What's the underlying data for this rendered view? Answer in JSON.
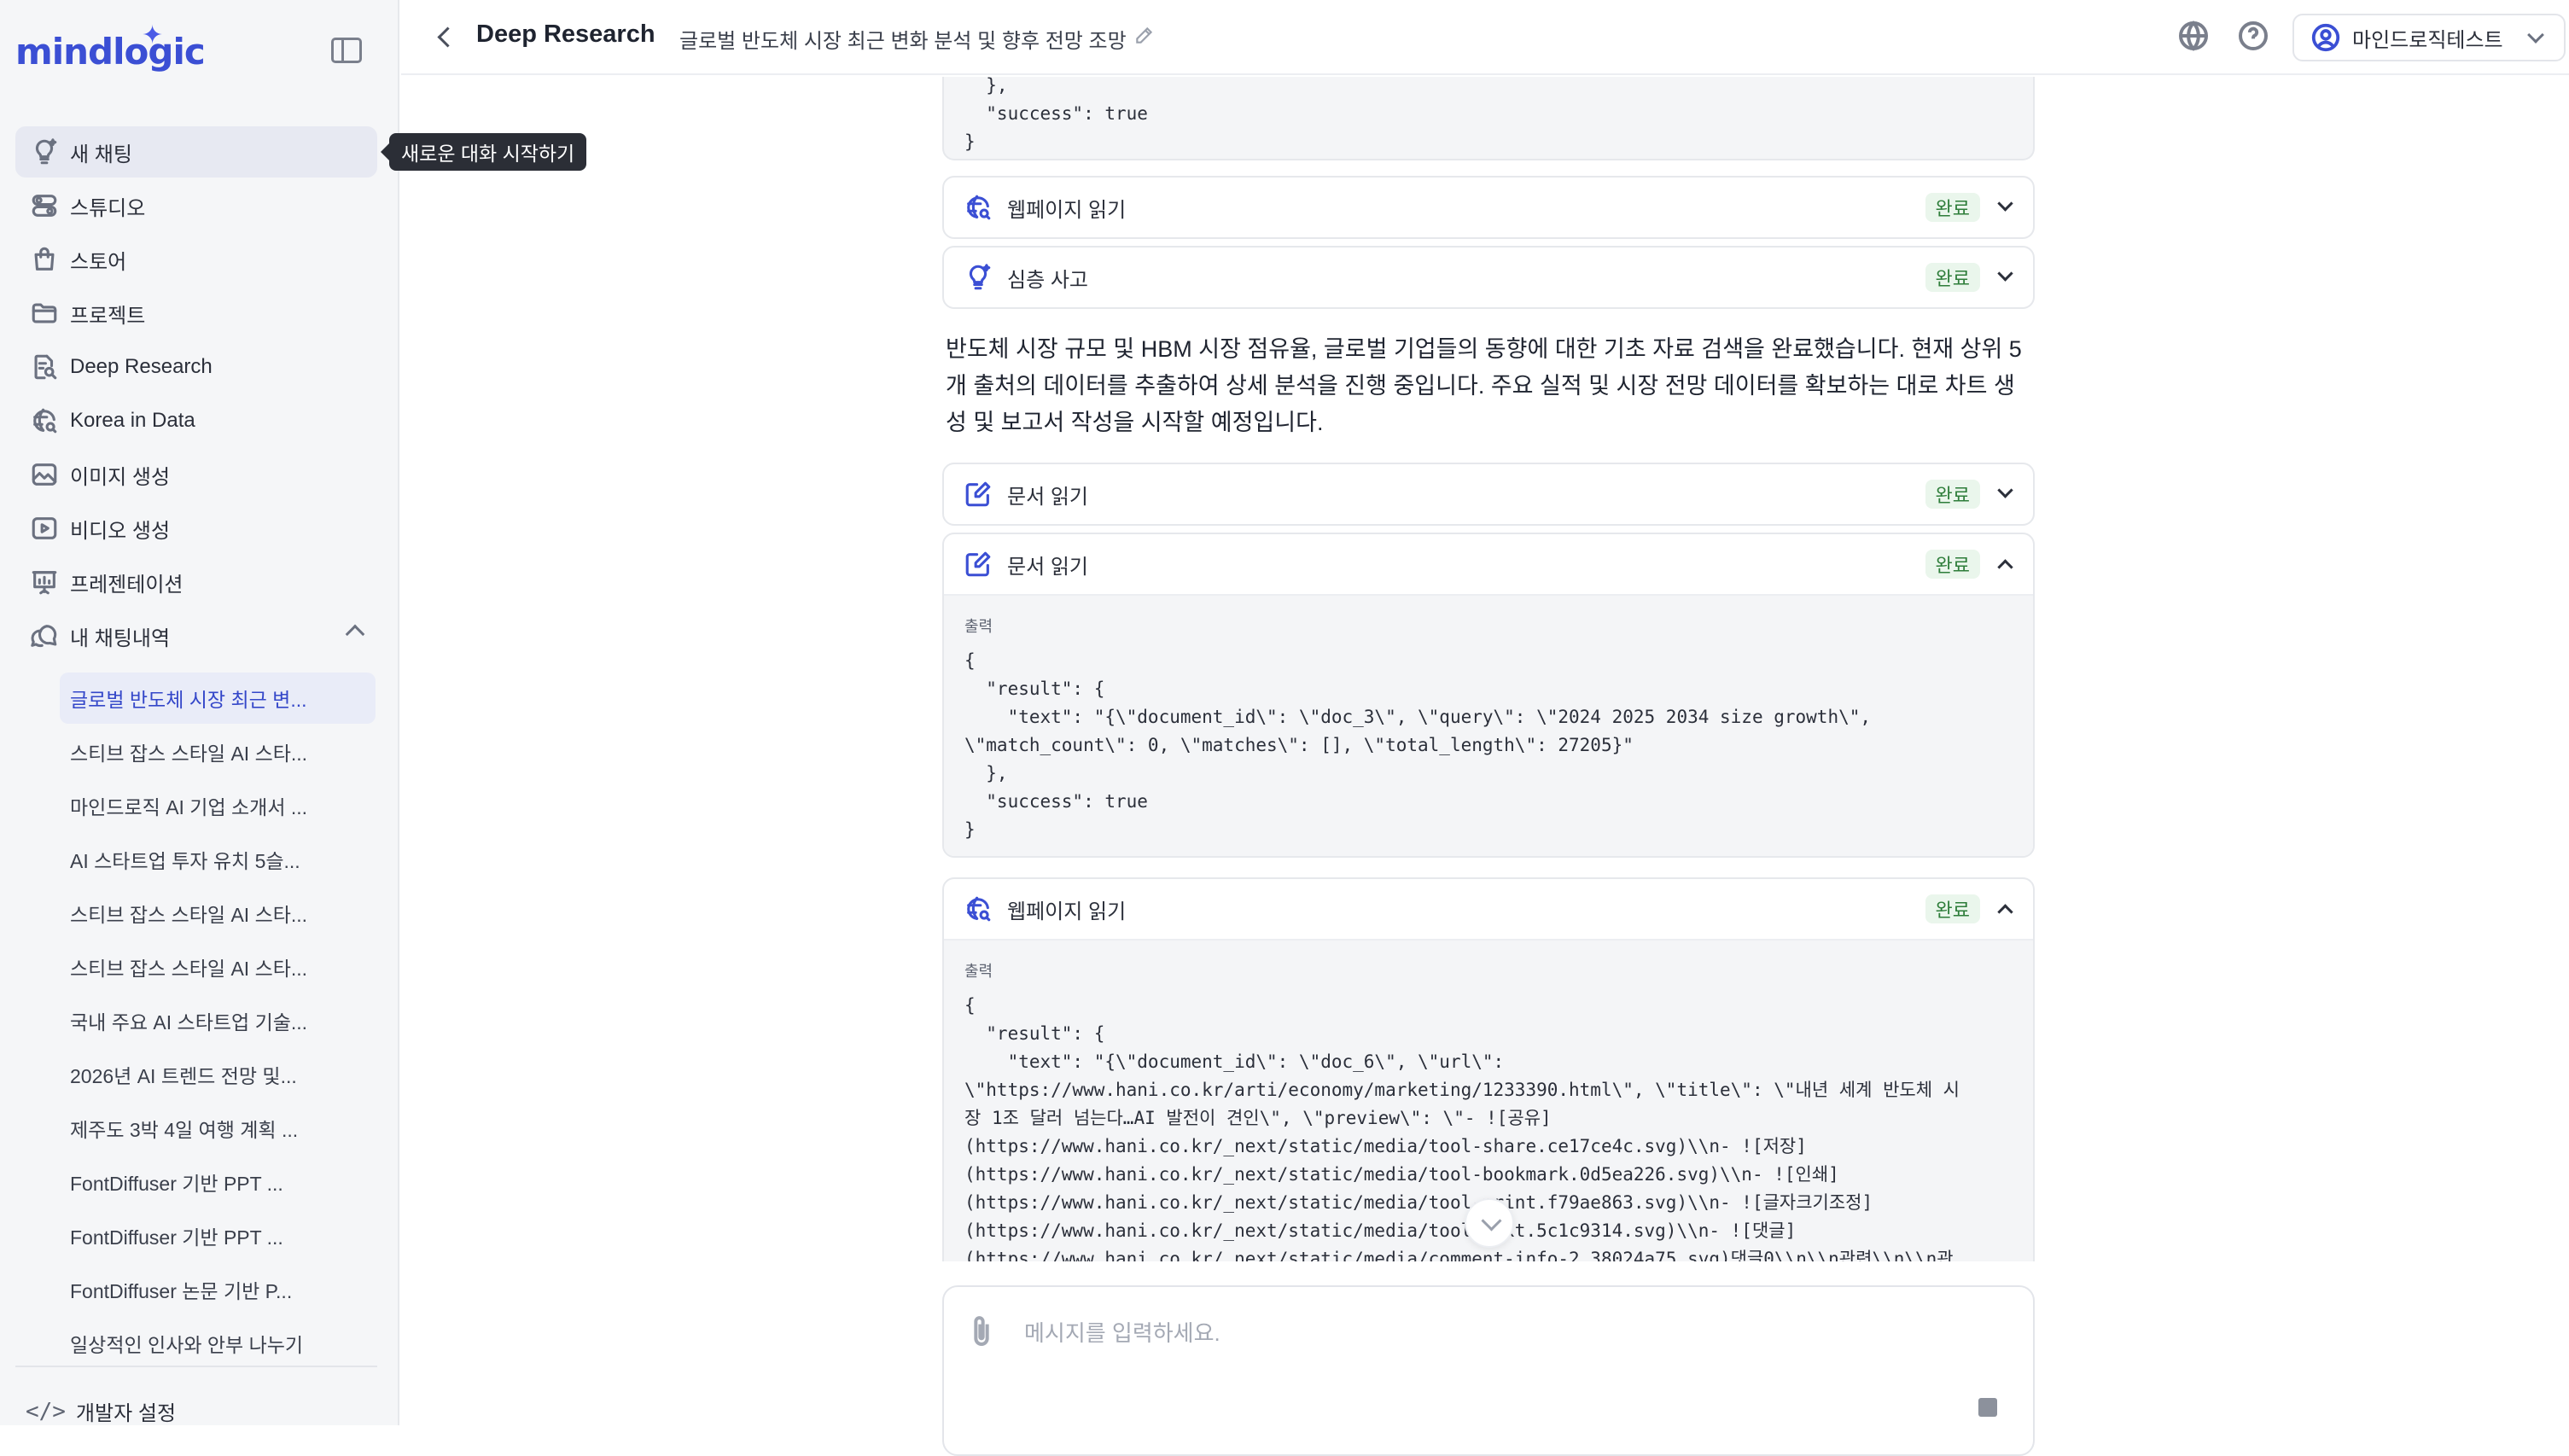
{
  "app": {
    "logo_text": "mindlogic",
    "tooltip": "새로운 대화 시작하기"
  },
  "sidebar": {
    "nav": [
      {
        "label": "새 채팅",
        "icon": "bulb-sparkle-icon"
      },
      {
        "label": "스튜디오",
        "icon": "toggle-stack-icon"
      },
      {
        "label": "스토어",
        "icon": "shopping-bag-icon"
      },
      {
        "label": "프로젝트",
        "icon": "folder-icon"
      },
      {
        "label": "Deep Research",
        "icon": "document-search-icon"
      },
      {
        "label": "Korea in Data",
        "icon": "globe-search-icon"
      },
      {
        "label": "이미지 생성",
        "icon": "image-icon"
      },
      {
        "label": "비디오 생성",
        "icon": "play-icon"
      },
      {
        "label": "프레젠테이션",
        "icon": "presentation-icon"
      },
      {
        "label": "내 채팅내역",
        "icon": "chat-history-icon"
      }
    ],
    "history": [
      "글로벌 반도체 시장 최근 변...",
      "스티브 잡스 스타일 AI 스타...",
      "마인드로직 AI 기업 소개서 ...",
      "AI 스타트업 투자 유치 5슬...",
      "스티브 잡스 스타일 AI 스타...",
      "스티브 잡스 스타일 AI 스타...",
      "국내 주요 AI 스타트업 기술...",
      "2026년 AI 트렌드 전망 및...",
      "제주도 3박 4일 여행 계획 ...",
      "FontDiffuser 기반 PPT ...",
      "FontDiffuser 기반 PPT ...",
      "FontDiffuser 논문 기반 P...",
      "일상적인 인사와 안부 나누기"
    ],
    "dev_settings": "개발자 설정"
  },
  "header": {
    "page_title": "Deep Research",
    "chat_title": "글로벌 반도체 시장 최근 변화 분석 및 향후 전망 조망",
    "user_name": "마인드로직테스트"
  },
  "main": {
    "top_code": "  },\n  \"success\": true\n}",
    "cards": [
      {
        "label": "웹페이지 읽기",
        "status": "완료",
        "icon": "globe-search-icon"
      },
      {
        "label": "심층 사고",
        "status": "완료",
        "icon": "bulb-sparkle-icon"
      },
      {
        "label": "문서 읽기",
        "status": "완료",
        "icon": "edit-icon"
      },
      {
        "label": "문서 읽기",
        "status": "완료",
        "icon": "edit-icon",
        "output_label": "출력",
        "output": "{\n  \"result\": {\n    \"text\": \"{\\\"document_id\\\": \\\"doc_3\\\", \\\"query\\\": \\\"2024 2025 2034 size growth\\\",\n\\\"match_count\\\": 0, \\\"matches\\\": [], \\\"total_length\\\": 27205}\"\n  },\n  \"success\": true\n}"
      },
      {
        "label": "웹페이지 읽기",
        "status": "완료",
        "icon": "globe-search-icon",
        "output_label": "출력",
        "output": "{\n  \"result\": {\n    \"text\": \"{\\\"document_id\\\": \\\"doc_6\\\", \\\"url\\\":\n\\\"https://www.hani.co.kr/arti/economy/marketing/1233390.html\\\", \\\"title\\\": \\\"내년 세계 반도체 시\n장 1조 달러 넘는다…AI 발전이 견인\\\", \\\"preview\\\": \\\"- ![공유]\n(https://www.hani.co.kr/_next/static/media/tool-share.ce17ce4c.svg)\\\\n- ![저장]\n(https://www.hani.co.kr/_next/static/media/tool-bookmark.0d5ea226.svg)\\\\n- ![인쇄]\n(https://www.hani.co.kr/_next/static/media/tool-print.f79ae863.svg)\\\\n- ![글자크기조정]\n(https://www.hani.co.kr/_next/static/media/tool-text.5c1c9314.svg)\\\\n- ![댓글]\n(https://www.hani.co.kr/_next/static/media/comment-info-2.38024a75.svg)댓글0\\\\n\\\\n관련\\\\n\\\\n관"
      }
    ],
    "narrative": "반도체 시장 규모 및 HBM 시장 점유율, 글로벌 기업들의 동향에 대한 기초 자료 검색을 완료했습니다. 현재 상위 5개 출처의 데이터를 추출하여 상세 분석을 진행 중입니다. 주요 실적 및 시장 전망 데이터를 확보하는 대로 차트 생성 및 보고서 작성을 시작할 예정입니다."
  },
  "composer": {
    "placeholder": "메시지를 입력하세요.",
    "value": ""
  },
  "colors": {
    "accent": "#3b4fd4",
    "done_badge_bg": "#eaf6ec",
    "done_badge_text": "#2e7d3a"
  }
}
